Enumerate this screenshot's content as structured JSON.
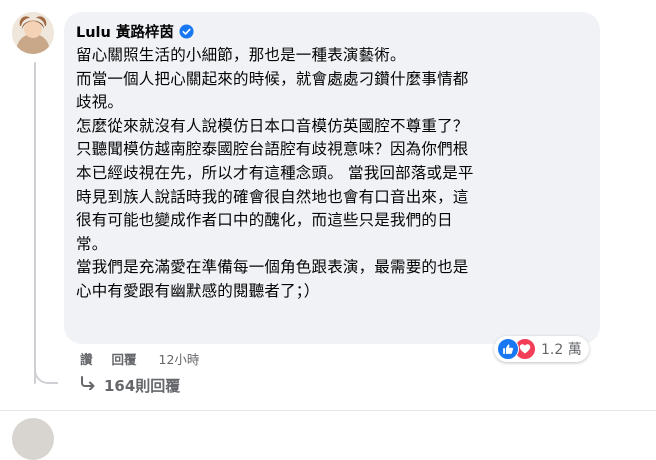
{
  "comment": {
    "author": "Lulu 黃路梓茵",
    "verified": true,
    "lines": [
      "留心關照生活的小細節，那也是一種表演藝術。",
      "而當一個人把心關起來的時候，就會處處刁鑽什麼事情都",
      "歧視。",
      "怎麼從來就沒有人說模仿日本口音模仿英國腔不尊重了？",
      "只聽聞模仿越南腔泰國腔台語腔有歧視意味？因為你們根",
      "本已經歧視在先，所以才有這種念頭。 當我回部落或是平",
      "時見到族人說話時我的確會很自然地也會有口音出來，這",
      "很有可能也變成作者口中的醜化，而這些只是我們的日",
      "常。",
      "當我們是充滿愛在準備每一個角色跟表演，最需要的也是",
      "心中有愛跟有幽默感的閱聽者了；）"
    ]
  },
  "actions": {
    "like_label": "讚",
    "reply_label": "回覆",
    "timestamp": "12小時"
  },
  "reactions": {
    "count": "1.2 萬",
    "types": [
      "like-icon",
      "love-icon"
    ],
    "colors": {
      "like": "#1877f2",
      "love": "#f33e58"
    }
  },
  "replies": {
    "label": "164則回覆",
    "icon": "reply-arrow-icon"
  },
  "colors": {
    "bubble": "#f0f2f5",
    "secondary_text": "#65676b",
    "verified": "#1877f2",
    "thread_line": "#ced0d4"
  }
}
